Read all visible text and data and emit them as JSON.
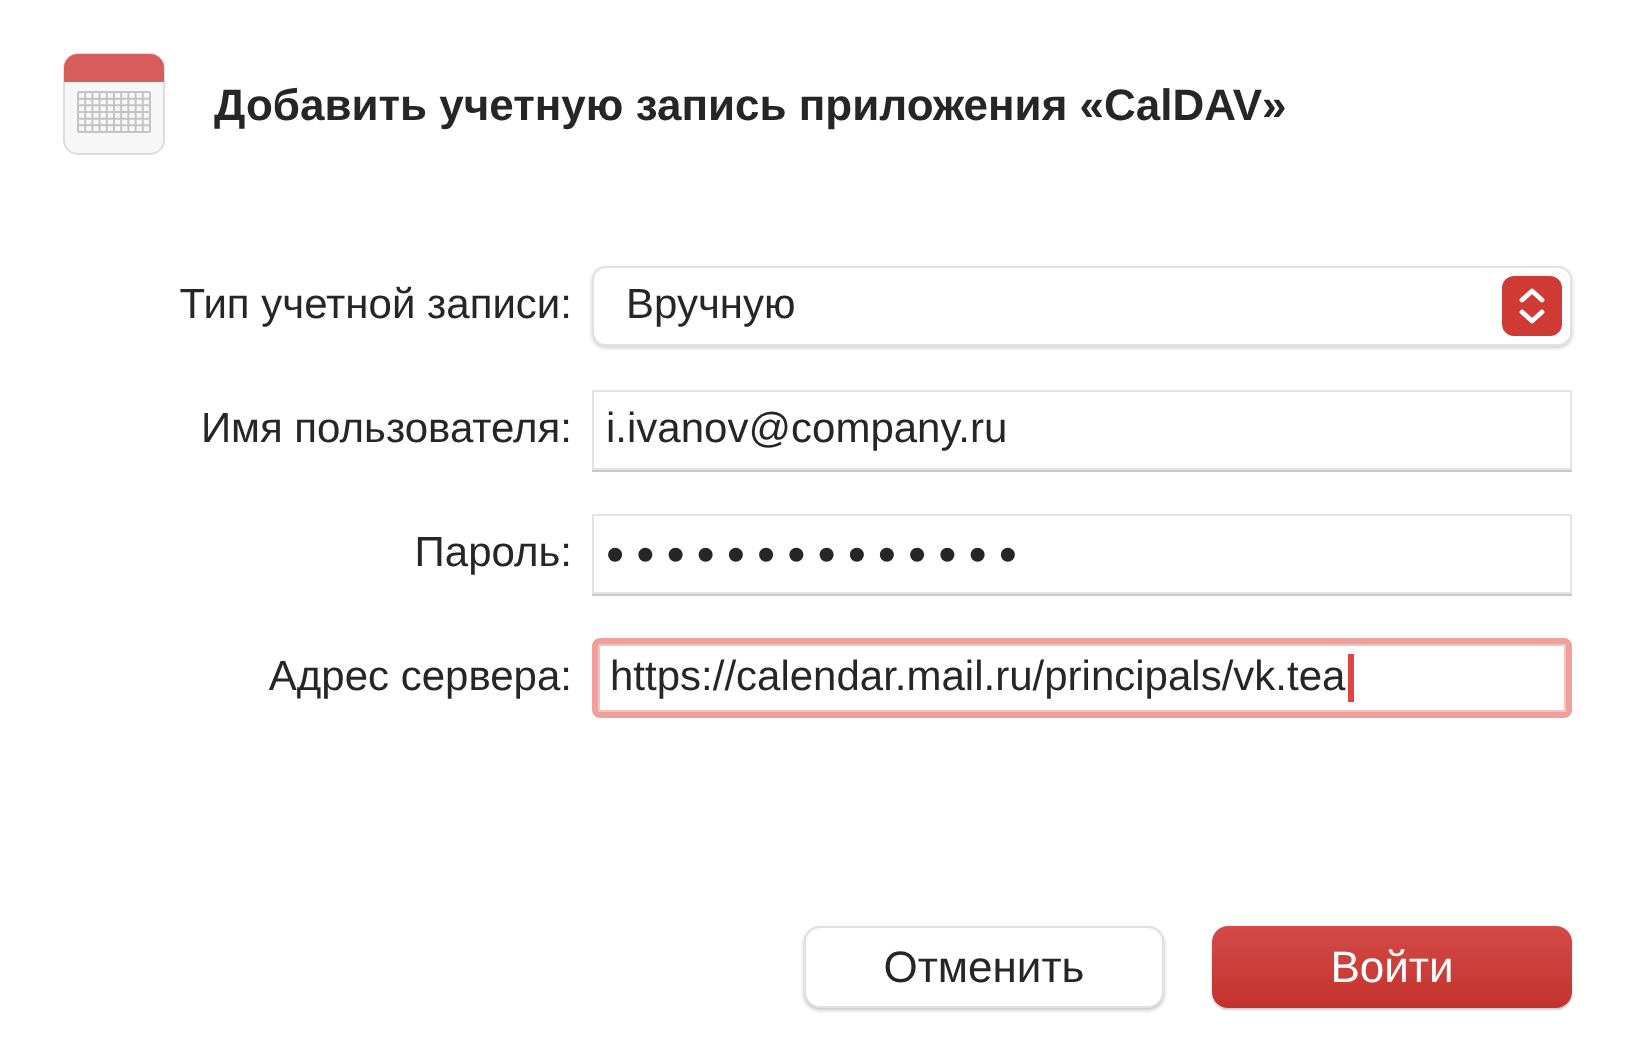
{
  "dialog": {
    "title": "Добавить учетную запись приложения «CalDAV»"
  },
  "fields": [
    {
      "kind": "popup",
      "label": "Тип учетной записи:",
      "value": "Вручную",
      "focused": false
    },
    {
      "kind": "text",
      "label": "Имя пользователя:",
      "value": "i.ivanov@company.ru",
      "focused": false
    },
    {
      "kind": "password",
      "label": "Пароль:",
      "value": "••••••••••••••",
      "focused": false
    },
    {
      "kind": "text",
      "label": "Адрес сервера:",
      "value": "https://calendar.mail.ru/principals/vk.tea",
      "focused": true
    }
  ],
  "buttons": [
    {
      "kind": "default",
      "label": "Отменить"
    },
    {
      "kind": "primary",
      "label": "Войти"
    }
  ]
}
